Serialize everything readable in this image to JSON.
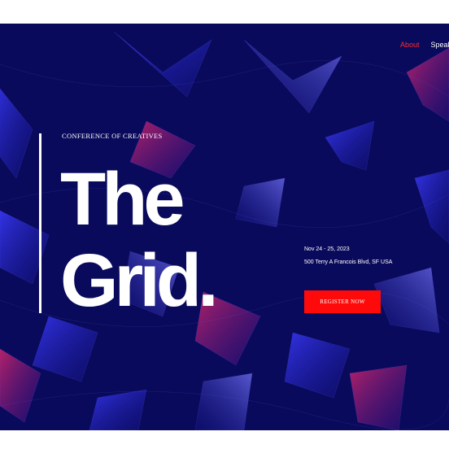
{
  "theme": {
    "background": "#0a0a5c",
    "accent": "#ff0a0a",
    "nav_active": "#ff2a2a",
    "text": "#ffffff"
  },
  "nav": {
    "items": [
      {
        "label": "About",
        "active": true
      },
      {
        "label": "Speakers",
        "active": false
      }
    ]
  },
  "hero": {
    "eyebrow": "CONFERENCE OF CREATIVES",
    "title_line1": "The",
    "title_line2": "Grid.",
    "date": "Nov 24 - 25, 2023",
    "address": "500 Terry A Francois Blvd, SF USA",
    "cta_label": "REGISTER NOW"
  }
}
